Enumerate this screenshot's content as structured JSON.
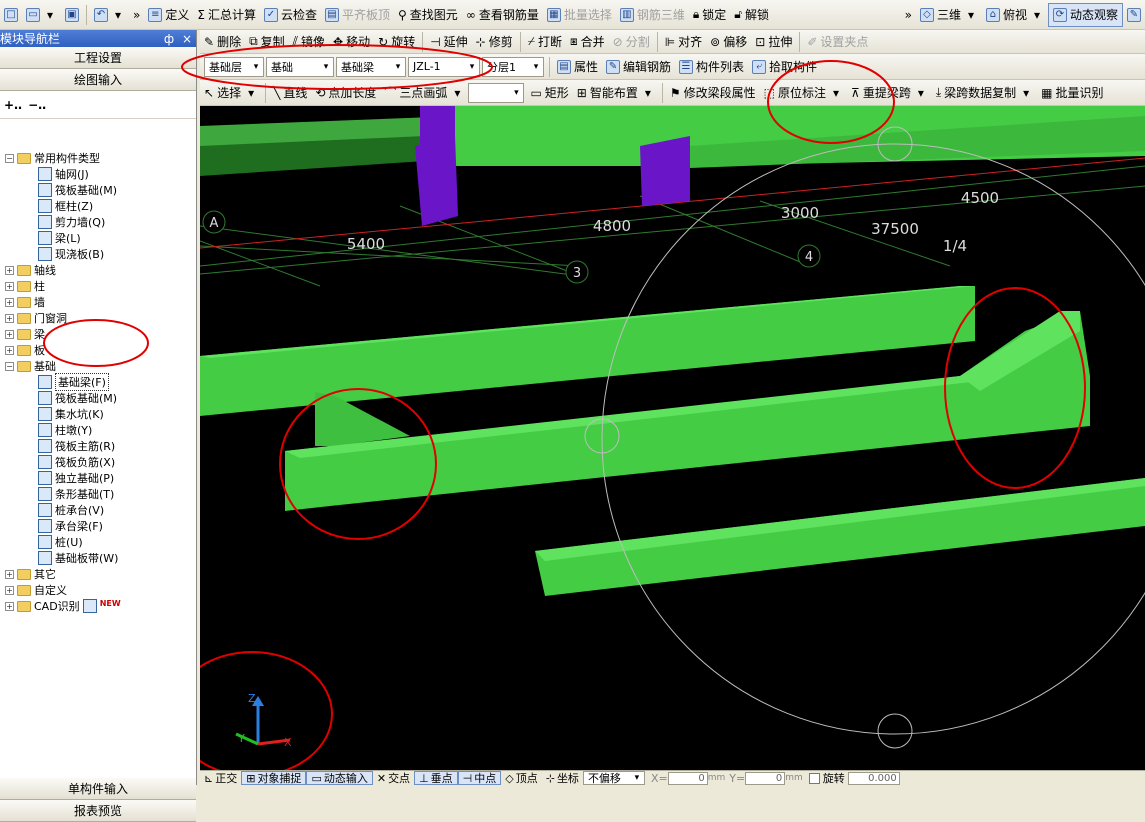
{
  "toolbar1": {
    "items": [
      {
        "label": "",
        "icon": "new-file-icon"
      },
      {
        "label": "",
        "icon": "open-folder-icon"
      },
      {
        "label": "",
        "icon": "save-icon"
      },
      {
        "label": "",
        "icon": "undo-icon"
      },
      {
        "label": "定义",
        "icon": "define-icon"
      },
      {
        "label": "汇总计算",
        "icon": "sigma-icon"
      },
      {
        "label": "云检查",
        "icon": "cloud-check-icon"
      },
      {
        "label": "平齐板顶",
        "icon": "align-top-icon",
        "disabled": true
      },
      {
        "label": "查找图元",
        "icon": "binoculars-icon"
      },
      {
        "label": "查看钢筋量",
        "icon": "view-rebar-icon"
      },
      {
        "label": "批量选择",
        "icon": "batch-select-icon",
        "disabled": true
      },
      {
        "label": "钢筋三维",
        "icon": "rebar-3d-icon",
        "disabled": true
      },
      {
        "label": "锁定",
        "icon": "lock-icon"
      },
      {
        "label": "解锁",
        "icon": "unlock-icon"
      }
    ],
    "right_items": [
      {
        "label": "三维",
        "icon": "cube-3d-icon"
      },
      {
        "label": "俯视",
        "icon": "top-view-icon"
      },
      {
        "label": "动态观察",
        "icon": "orbit-icon",
        "active": true
      }
    ]
  },
  "nav": {
    "title": "模块导航栏",
    "pin": "ф",
    "close": "×",
    "project_settings": "工程设置",
    "drawing_input": "绘图输入",
    "single_input": "单构件输入",
    "report_preview": "报表预览"
  },
  "tree": [
    {
      "level": 0,
      "label": "常用构件类型",
      "expanded": true
    },
    {
      "level": 1,
      "label": "轴网(J)"
    },
    {
      "level": 1,
      "label": "筏板基础(M)"
    },
    {
      "level": 1,
      "label": "框柱(Z)"
    },
    {
      "level": 1,
      "label": "剪力墙(Q)"
    },
    {
      "level": 1,
      "label": "梁(L)"
    },
    {
      "level": 1,
      "label": "现浇板(B)"
    },
    {
      "level": 0,
      "label": "轴线",
      "expanded": false
    },
    {
      "level": 0,
      "label": "柱",
      "expanded": false
    },
    {
      "level": 0,
      "label": "墙",
      "expanded": false
    },
    {
      "level": 0,
      "label": "门窗洞",
      "expanded": false
    },
    {
      "level": 0,
      "label": "梁",
      "expanded": false
    },
    {
      "level": 0,
      "label": "板",
      "expanded": false
    },
    {
      "level": 0,
      "label": "基础",
      "expanded": true
    },
    {
      "level": 1,
      "label": "基础梁(F)",
      "selected": true
    },
    {
      "level": 1,
      "label": "筏板基础(M)"
    },
    {
      "level": 1,
      "label": "集水坑(K)"
    },
    {
      "level": 1,
      "label": "柱墩(Y)"
    },
    {
      "level": 1,
      "label": "筏板主筋(R)"
    },
    {
      "level": 1,
      "label": "筏板负筋(X)"
    },
    {
      "level": 1,
      "label": "独立基础(P)"
    },
    {
      "level": 1,
      "label": "条形基础(T)"
    },
    {
      "level": 1,
      "label": "桩承台(V)"
    },
    {
      "level": 1,
      "label": "承台梁(F)"
    },
    {
      "level": 1,
      "label": "桩(U)"
    },
    {
      "level": 1,
      "label": "基础板带(W)"
    },
    {
      "level": 0,
      "label": "其它",
      "expanded": false
    },
    {
      "level": 0,
      "label": "自定义",
      "expanded": false
    },
    {
      "level": 0,
      "label": "CAD识别",
      "expanded": false,
      "badge": "NEW"
    }
  ],
  "toolbar2": [
    "删除",
    "复制",
    "镜像",
    "移动",
    "旋转",
    "延伸",
    "修剪",
    "打断",
    "合并",
    "分割",
    "对齐",
    "偏移",
    "拉伸",
    "设置夹点"
  ],
  "toolbar3": {
    "floor": "基础层",
    "category": "基础",
    "type": "基础梁",
    "component": "JZL-1",
    "layer": "分层1",
    "buttons": [
      "属性",
      "编辑钢筋",
      "构件列表",
      "拾取构件"
    ]
  },
  "toolbar4": [
    "选择",
    "直线",
    "点加长度",
    "三点画弧",
    "矩形",
    "智能布置",
    "修改梁段属性",
    "原位标注",
    "重提梁跨",
    "梁跨数据复制",
    "批量识别"
  ],
  "viewport": {
    "axis_labels": [
      "A",
      "3",
      "4",
      "1/4"
    ],
    "dimensions": [
      "5400",
      "4800",
      "3000",
      "4500",
      "37500"
    ],
    "axis_x": "X",
    "axis_y": "Y",
    "axis_z": "Z"
  },
  "statusbar": {
    "items": [
      "正交",
      "对象捕捉",
      "动态输入",
      "交点",
      "垂点",
      "中点",
      "顶点",
      "坐标",
      "不偏移"
    ],
    "x_label": "X=",
    "x_value": "0",
    "y_label": "Y=",
    "y_value": "0",
    "unit": "mm",
    "rotate_label": "旋转",
    "rotate_value": "0.000"
  },
  "colors": {
    "beam_green": "#44cc44",
    "column_purple": "#6a16c8",
    "annotation_red": "#e00000",
    "axis_red": "#cc2222",
    "grid_green": "#2f7a2f"
  }
}
